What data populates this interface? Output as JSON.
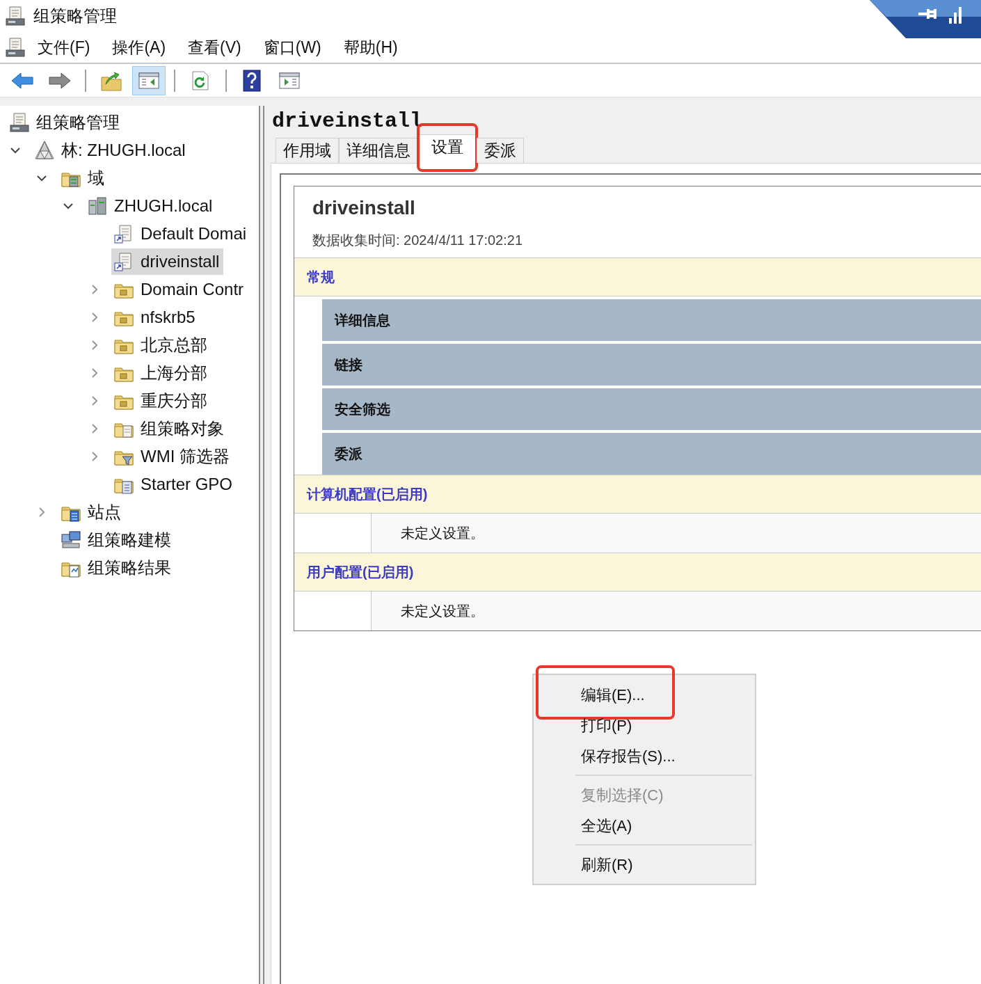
{
  "window": {
    "title": "组策略管理"
  },
  "menu": [
    "文件(F)",
    "操作(A)",
    "查看(V)",
    "窗口(W)",
    "帮助(H)"
  ],
  "toolbar_groups": [
    {
      "buttons": [
        {
          "kind": "back",
          "selected": false
        },
        {
          "kind": "forward",
          "selected": false
        }
      ]
    },
    {
      "buttons": [
        {
          "kind": "up",
          "selected": false
        },
        {
          "kind": "pane",
          "selected": true
        }
      ]
    },
    {
      "buttons": [
        {
          "kind": "refresh",
          "selected": false
        }
      ]
    },
    {
      "buttons": [
        {
          "kind": "help",
          "selected": false
        },
        {
          "kind": "action-pane",
          "selected": false
        }
      ]
    }
  ],
  "tree": {
    "label": "组策略管理",
    "kind": "console",
    "selected": false,
    "children": [
      {
        "label": "林: ZHUGH.local",
        "kind": "forest",
        "selected": false,
        "expanded": true,
        "children": [
          {
            "label": "域",
            "kind": "domains",
            "selected": false,
            "expanded": true,
            "children": [
              {
                "label": "ZHUGH.local",
                "kind": "domain",
                "selected": false,
                "expanded": true,
                "children": [
                  {
                    "label": "Default Domai",
                    "kind": "gpo-link",
                    "selected": false
                  },
                  {
                    "label": "driveinstall",
                    "kind": "gpo-link",
                    "selected": true
                  },
                  {
                    "label": "Domain Contr",
                    "kind": "ou",
                    "selected": false,
                    "expanded": false
                  },
                  {
                    "label": "nfskrb5",
                    "kind": "ou",
                    "selected": false,
                    "expanded": false
                  },
                  {
                    "label": "北京总部",
                    "kind": "ou",
                    "selected": false,
                    "expanded": false
                  },
                  {
                    "label": "上海分部",
                    "kind": "ou",
                    "selected": false,
                    "expanded": false
                  },
                  {
                    "label": "重庆分部",
                    "kind": "ou",
                    "selected": false,
                    "expanded": false
                  },
                  {
                    "label": "组策略对象",
                    "kind": "gpo-folder",
                    "selected": false,
                    "expanded": false
                  },
                  {
                    "label": "WMI 筛选器",
                    "kind": "wmi",
                    "selected": false,
                    "expanded": false
                  },
                  {
                    "label": "Starter GPO",
                    "kind": "starter",
                    "selected": false
                  }
                ]
              }
            ]
          },
          {
            "label": "站点",
            "kind": "sites",
            "selected": false,
            "expanded": false
          },
          {
            "label": "组策略建模",
            "kind": "modeling",
            "selected": false
          },
          {
            "label": "组策略结果",
            "kind": "results",
            "selected": false
          }
        ]
      }
    ]
  },
  "details": {
    "title": "driveinstall",
    "tabs": [
      {
        "label": "作用域",
        "selected": false,
        "highlighted": false
      },
      {
        "label": "详细信息",
        "selected": false,
        "highlighted": false
      },
      {
        "label": "设置",
        "selected": true,
        "highlighted": true
      },
      {
        "label": "委派",
        "selected": false,
        "highlighted": false
      }
    ],
    "report": {
      "title": "driveinstall",
      "collected": "数据收集时间: 2024/4/11 17:02:21",
      "sections": [
        {
          "title": "常规",
          "rows": [
            {
              "kind": "subheading",
              "text": "详细信息"
            },
            {
              "kind": "subheading",
              "text": "链接"
            },
            {
              "kind": "subheading",
              "text": "安全筛选"
            },
            {
              "kind": "subheading",
              "text": "委派"
            }
          ]
        },
        {
          "title": "计算机配置(已启用)",
          "rows": [
            {
              "kind": "note",
              "text": "未定义设置。"
            }
          ]
        },
        {
          "title": "用户配置(已启用)",
          "rows": [
            {
              "kind": "note",
              "text": "未定义设置。"
            }
          ]
        }
      ]
    }
  },
  "context_menu": [
    {
      "kind": "item",
      "label": "编辑(E)...",
      "disabled": false,
      "highlighted": true
    },
    {
      "kind": "item",
      "label": "打印(P)",
      "disabled": false,
      "highlighted": false
    },
    {
      "kind": "item",
      "label": "保存报告(S)...",
      "disabled": false,
      "highlighted": false
    },
    {
      "kind": "separator"
    },
    {
      "kind": "item",
      "label": "复制选择(C)",
      "disabled": true,
      "highlighted": false
    },
    {
      "kind": "item",
      "label": "全选(A)",
      "disabled": false,
      "highlighted": false
    },
    {
      "kind": "separator"
    },
    {
      "kind": "item",
      "label": "刷新(R)",
      "disabled": false,
      "highlighted": false
    }
  ]
}
